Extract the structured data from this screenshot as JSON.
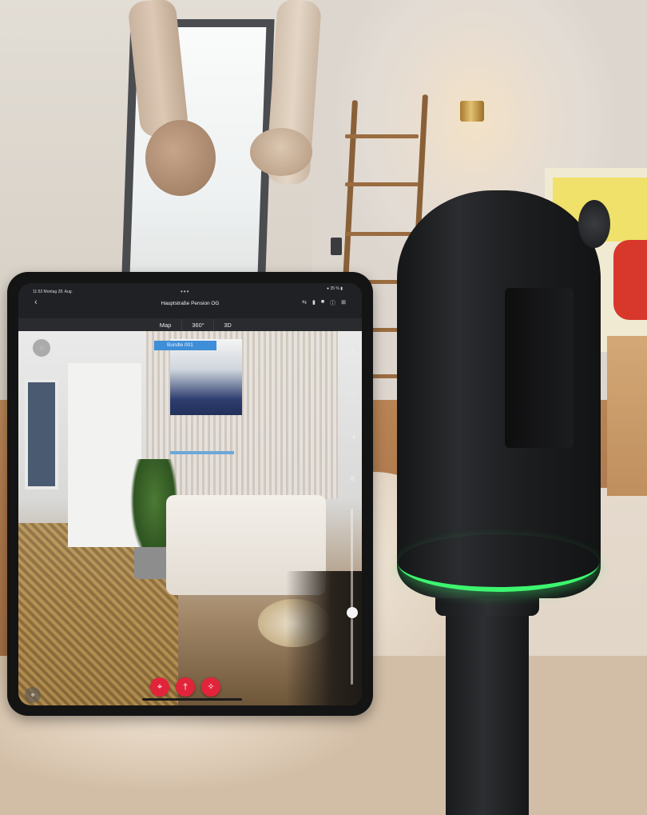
{
  "app": {
    "status": {
      "time": "11:53  Montag 28. Aug.",
      "battery": "● 35 % ▮"
    },
    "nav": {
      "back_icon": "‹",
      "more_icon": "•••",
      "title": "Hauptstraße Pension OG"
    },
    "toolbar_icons": [
      {
        "name": "swap-icon",
        "glyph": "⇆"
      },
      {
        "name": "battery-icon",
        "glyph": "▮"
      },
      {
        "name": "scanner-icon",
        "glyph": "■"
      },
      {
        "name": "info-icon",
        "glyph": "ⓘ"
      },
      {
        "name": "layout-icon",
        "glyph": "⊞"
      }
    ],
    "tabs": [
      {
        "label": "Map"
      },
      {
        "label": "360°"
      },
      {
        "label": "3D",
        "active": true
      }
    ],
    "bundle_label": "Bundle 001",
    "icons": {
      "chat": "◌",
      "layers": "▲",
      "filter": "○",
      "measure": "▾",
      "settings": "⚙",
      "locate": "⌖"
    },
    "fab_icons": [
      "⌖",
      "†",
      "✧"
    ],
    "accent_color": "#e2243b",
    "bundle_color": "#3e8ed8"
  }
}
